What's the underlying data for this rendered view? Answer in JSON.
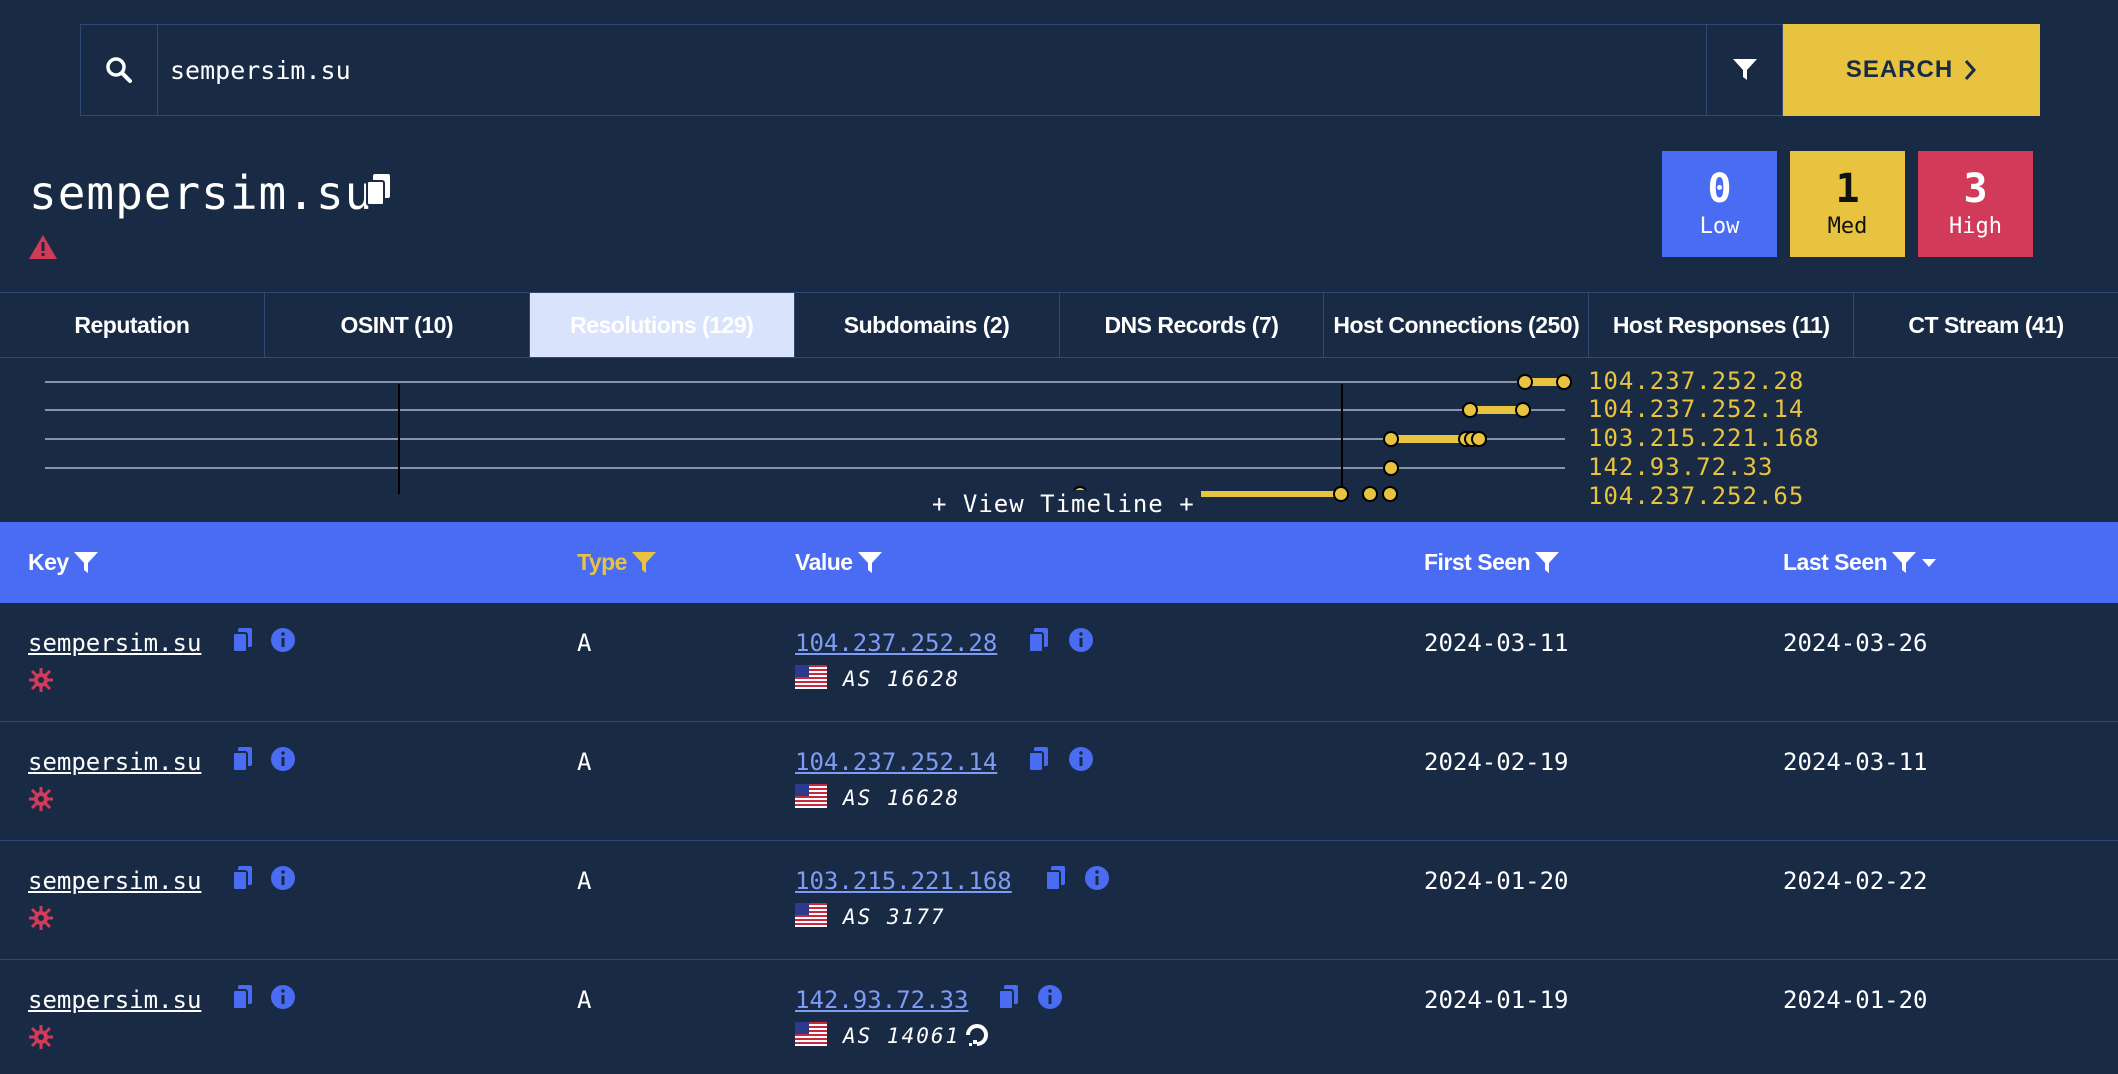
{
  "search": {
    "value": "sempersim.su",
    "button_label": "SEARCH"
  },
  "header": {
    "domain": "sempersim.su"
  },
  "risk": [
    {
      "count": "0",
      "label": "Low",
      "color": "#4a6cf2"
    },
    {
      "count": "1",
      "label": "Med",
      "color": "#e8c33f"
    },
    {
      "count": "3",
      "label": "High",
      "color": "#d23a5a"
    }
  ],
  "tabs": [
    {
      "label": "Reputation",
      "active": false
    },
    {
      "label": "OSINT (10)",
      "active": false
    },
    {
      "label": "Resolutions (129)",
      "active": true
    },
    {
      "label": "Subdomains (2)",
      "active": false
    },
    {
      "label": "DNS Records (7)",
      "active": false
    },
    {
      "label": "Host Connections (250)",
      "active": false
    },
    {
      "label": "Host Responses (11)",
      "active": false
    },
    {
      "label": "CT Stream (41)",
      "active": false
    }
  ],
  "timeline": {
    "labels": [
      "104.237.252.28",
      "104.237.252.14",
      "103.215.221.168",
      "142.93.72.33",
      "104.237.252.65"
    ],
    "view_label": "+ View Timeline +"
  },
  "table": {
    "columns": {
      "key": "Key",
      "type": "Type",
      "value": "Value",
      "first_seen": "First Seen",
      "last_seen": "Last Seen"
    },
    "rows": [
      {
        "key": "sempersim.su",
        "type": "A",
        "value": "104.237.252.28",
        "asn": "AS 16628",
        "first_seen": "2024-03-11",
        "last_seen": "2024-03-26"
      },
      {
        "key": "sempersim.su",
        "type": "A",
        "value": "104.237.252.14",
        "asn": "AS 16628",
        "first_seen": "2024-02-19",
        "last_seen": "2024-03-11"
      },
      {
        "key": "sempersim.su",
        "type": "A",
        "value": "103.215.221.168",
        "asn": "AS 3177",
        "first_seen": "2024-01-20",
        "last_seen": "2024-02-22"
      },
      {
        "key": "sempersim.su",
        "type": "A",
        "value": "142.93.72.33",
        "asn": "AS 14061",
        "first_seen": "2024-01-19",
        "last_seen": "2024-01-20"
      }
    ]
  },
  "colors": {
    "background": "#182a44",
    "accent_blue": "#4a6cf2",
    "accent_yellow": "#e8c33f",
    "danger": "#d23a5a",
    "link": "#7f9cf5"
  }
}
